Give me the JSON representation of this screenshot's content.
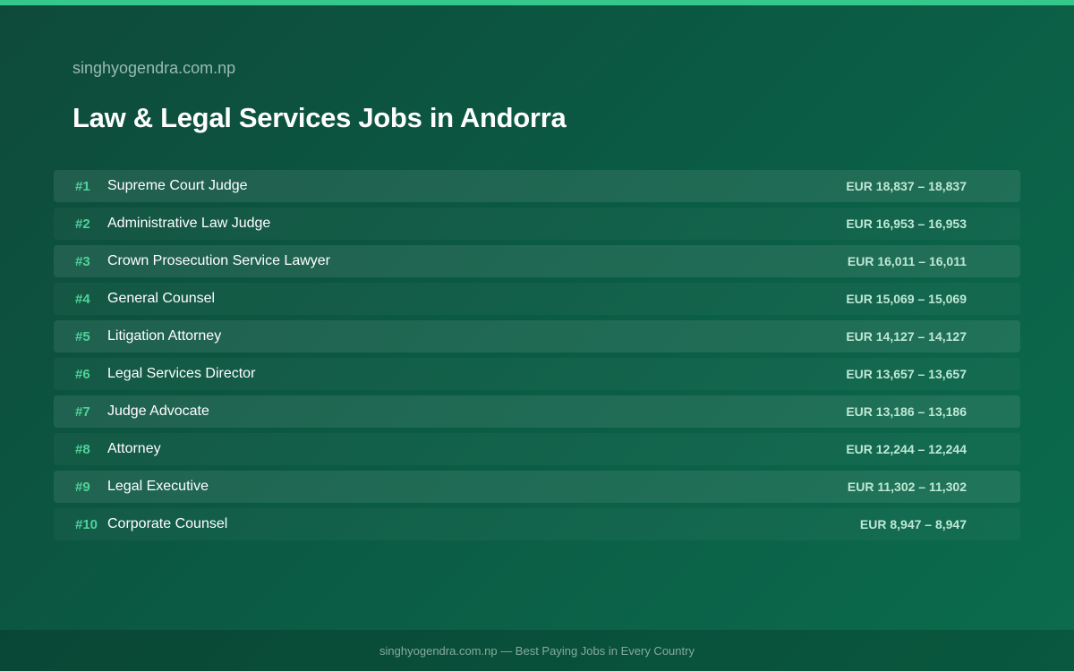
{
  "header": {
    "site_name": "singhyogendra.com.np",
    "title": "Law & Legal Services Jobs in Andorra"
  },
  "colors": {
    "accent": "#34c98a",
    "rank": "#4fd39a",
    "background_start": "#0e4a3a",
    "background_end": "#0b6c4d"
  },
  "jobs": [
    {
      "rank": "#1",
      "title": "Supreme Court Judge",
      "salary": "EUR 18,837 – 18,837"
    },
    {
      "rank": "#2",
      "title": "Administrative Law Judge",
      "salary": "EUR 16,953 – 16,953"
    },
    {
      "rank": "#3",
      "title": "Crown Prosecution Service Lawyer",
      "salary": "EUR 16,011 – 16,011"
    },
    {
      "rank": "#4",
      "title": "General Counsel",
      "salary": "EUR 15,069 – 15,069"
    },
    {
      "rank": "#5",
      "title": "Litigation Attorney",
      "salary": "EUR 14,127 – 14,127"
    },
    {
      "rank": "#6",
      "title": "Legal Services Director",
      "salary": "EUR 13,657 – 13,657"
    },
    {
      "rank": "#7",
      "title": "Judge Advocate",
      "salary": "EUR 13,186 – 13,186"
    },
    {
      "rank": "#8",
      "title": "Attorney",
      "salary": "EUR 12,244 – 12,244"
    },
    {
      "rank": "#9",
      "title": "Legal Executive",
      "salary": "EUR 11,302 – 11,302"
    },
    {
      "rank": "#10",
      "title": "Corporate Counsel",
      "salary": "EUR 8,947 – 8,947"
    }
  ],
  "footer": {
    "text": "singhyogendra.com.np — Best Paying Jobs in Every Country"
  }
}
